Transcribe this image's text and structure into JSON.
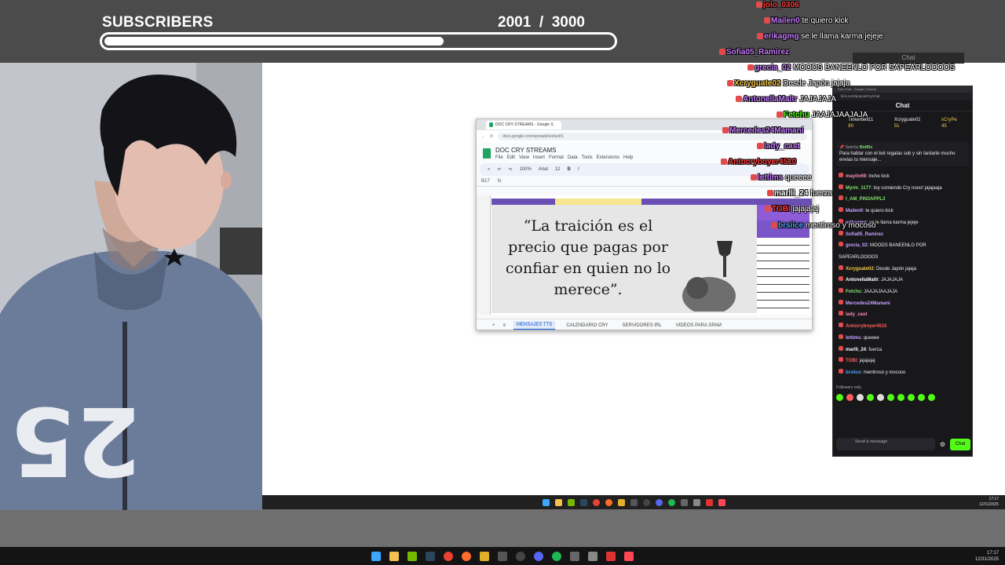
{
  "overlay_top": {
    "subscribers_label": "SUBSCRIBERS",
    "subscribers_current": "2001",
    "subscribers_goal": "3000",
    "subscribers_progress": 0.667
  },
  "overlay_chat": [
    {
      "user": "jolo_0306",
      "text": "",
      "color": "#ff3b3b"
    },
    {
      "user": "Mailen0",
      "text": "te quiero kick",
      "color": "#c77dff"
    },
    {
      "user": "erikagmg",
      "text": "se le llama karma jejeje",
      "color": "#c77dff"
    },
    {
      "user": "Sofia05_Ramirez",
      "text": "",
      "color": "#c77dff"
    },
    {
      "user": "grecia_02",
      "text": "MOODS BANEENLO POR SAPEARLOOOOS",
      "color": "#c77dff"
    },
    {
      "user": "Xcryguate02",
      "text": "Desde Japón jajaja",
      "color": "#f6c744"
    },
    {
      "user": "AntonellaMaitr",
      "text": "JAJAJAJA",
      "color": "#c77dff"
    },
    {
      "user": "Fetchu",
      "text": "JAAJAJAAJAJA",
      "color": "#53fc18"
    },
    {
      "user": "Mercedes24Mamani",
      "text": "",
      "color": "#c77dff"
    },
    {
      "user": "lady_cast",
      "text": "",
      "color": "#c77dff"
    },
    {
      "user": "Antocryboyer4510",
      "text": "",
      "color": "#ff3b3b"
    },
    {
      "user": "lettims",
      "text": "queeee",
      "color": "#c77dff"
    },
    {
      "user": "marlli_24",
      "text": "fuerza",
      "color": "#ffffff"
    },
    {
      "user": "TOBI",
      "text": "jajajajaj",
      "color": "#ff3b3b"
    },
    {
      "user": "brsiice",
      "text": "mentiroso y mocoso",
      "color": "#4da3ff"
    }
  ],
  "ghost_chat_label": "Chat",
  "sheet": {
    "tab_title": "DOC CRY STREAMS - Google S",
    "url": "docs.google.com/spreadsheets/d/1",
    "doc_title": "DOC CRY STREAMS",
    "menus": [
      "File",
      "Edit",
      "View",
      "Insert",
      "Format",
      "Data",
      "Tools",
      "Extensions",
      "Help"
    ],
    "zoom": "100%",
    "font": "Arial",
    "font_size": "12",
    "cell_ref": "B17",
    "fx": "fx",
    "header_text": "DOC CRY STREAMS",
    "quote": "“La traición es el precio que pagas por confiar en quien no lo merece”.",
    "tabs": [
      "MENSAJES TTS",
      "CALENDARIO CRY",
      "SERVIDORES IRL",
      "VIDEOS PARA SPAM"
    ]
  },
  "chat_panel": {
    "window_title": "Kick Chat - Google Chrome",
    "address": "kick.com/popout/cry/chat",
    "title": "Chat",
    "leaders": [
      {
        "rank": "1",
        "name": "Tinkerbell11",
        "amount": "80"
      },
      {
        "rank": "",
        "name": "Xcryguate02",
        "amount": "51"
      },
      {
        "rank": "",
        "name": "xCryPe",
        "amount": "45"
      }
    ],
    "pinned_by": "Sent by",
    "pinned_bot": "BotRix",
    "pinned_text": "Para hablar con el bot regalas sub y sin tardarte mucho envias tu mensaje...",
    "messages": [
      {
        "user": "mayito69",
        "text": "inche kick",
        "color": "#f78fb3"
      },
      {
        "user": "Myrm_1177",
        "text": "toy comiendo Cry nooo! jajajaaja",
        "color": "#82e06f"
      },
      {
        "user": "I_AM_PIN3APPL3",
        "text": "",
        "color": "#82e06f"
      },
      {
        "user": "",
        "text": "",
        "color": "#ffffff"
      },
      {
        "user": "Mailen0",
        "text": "te quiero kick",
        "color": "#c9a0ff"
      },
      {
        "user": "erikagmg",
        "text": "se le llama karma jejeje",
        "color": "#c9a0ff"
      },
      {
        "user": "Sofia05_Ramirez",
        "text": "",
        "color": "#c9a0ff"
      },
      {
        "user": "grecia_02",
        "text": "MOODS BANEENLO POR",
        "color": "#c9a0ff"
      },
      {
        "user": "",
        "text": "SAPEARLOOOOS",
        "color": "#ffffff"
      },
      {
        "user": "Xcryguate02",
        "text": "Desde Japón jajaja",
        "color": "#f6c744"
      },
      {
        "user": "AntonellaMaitr",
        "text": "JAJAJAJA",
        "color": "#ffffff"
      },
      {
        "user": "Fetchu",
        "text": "JAAJAJAAJAJA",
        "color": "#82e06f"
      },
      {
        "user": "Mercedes24Mamani",
        "text": "",
        "color": "#c9a0ff"
      },
      {
        "user": "lady_cast",
        "text": "",
        "color": "#f78fb3"
      },
      {
        "user": "Antocryboyer4510",
        "text": "",
        "color": "#ff5c5c"
      },
      {
        "user": "lettims",
        "text": "queeee",
        "color": "#c9a0ff"
      },
      {
        "user": "marlli_24",
        "text": "fuerza",
        "color": "#ffffff"
      },
      {
        "user": "TOBI",
        "text": "jajajajaj",
        "color": "#ff5c5c"
      },
      {
        "user": "brsiice",
        "text": "mentiroso y mocoso",
        "color": "#4da3ff"
      }
    ],
    "followers_only": "Followers only",
    "input_placeholder": "Send a message",
    "chat_button": "Chat"
  },
  "taskbar_main": {
    "time": "17:17",
    "date": "12/31/2025"
  },
  "taskbar_bottom": {
    "time": "17:17",
    "date": "12/31/2025"
  },
  "colors": {
    "kick_green": "#53fc18",
    "purple": "#6a4fb5"
  }
}
